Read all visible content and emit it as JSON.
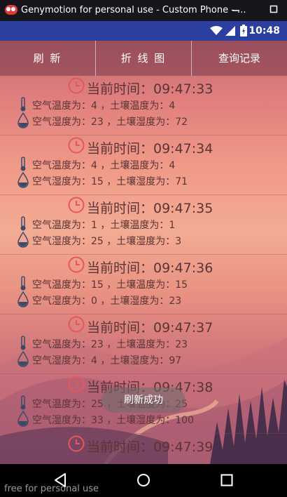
{
  "window": {
    "title": "Genymotion for personal use - Custom Phone - ...",
    "watermark": "free for personal use"
  },
  "statusbar": {
    "time": "10:48"
  },
  "toolbar": {
    "refresh_label": "刷 新",
    "chart_label": "折 线 图",
    "history_label": "查询记录"
  },
  "records": [
    {
      "time_line": "当前时间：09:47:33",
      "temp_line": "空气温度为：4 ，土壤温度为：4",
      "humid_line": "空气湿度为：23 ，土壤湿度为：72"
    },
    {
      "time_line": "当前时间：09:47:34",
      "temp_line": "空气温度为：4 ，土壤温度为：4",
      "humid_line": "空气湿度为：15 ，土壤湿度为：71"
    },
    {
      "time_line": "当前时间：09:47:35",
      "temp_line": "空气温度为：1 ，土壤温度为：1",
      "humid_line": "空气湿度为：25 ，土壤湿度为：3"
    },
    {
      "time_line": "当前时间：09:47:36",
      "temp_line": "空气温度为：15 ，土壤温度为：15",
      "humid_line": "空气湿度为：0 ，土壤湿度为：23"
    },
    {
      "time_line": "当前时间：09:47:37",
      "temp_line": "空气温度为：23 ，土壤温度为：23",
      "humid_line": "空气湿度为：4 ，土壤湿度为：97"
    },
    {
      "time_line": "当前时间：09:47:38",
      "temp_line": "空气温度为：25 ，土壤温度为：25",
      "humid_line": "空气湿度为：33 ，土壤湿度为：100"
    },
    {
      "time_line": "当前时间：09:47:39",
      "temp_line": "",
      "humid_line": ""
    }
  ],
  "toast": {
    "text": "刷新成功"
  },
  "colors": {
    "accent": "#e8565a",
    "statusbar": "#2b3fa0",
    "thermo": "#3c4a6a"
  }
}
